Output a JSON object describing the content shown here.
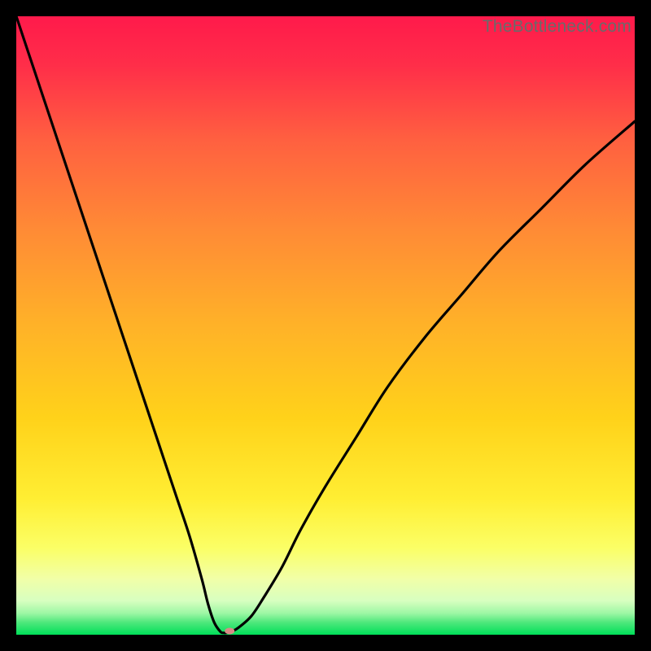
{
  "watermark": "TheBottleneck.com",
  "chart_data": {
    "type": "line",
    "title": "",
    "xlabel": "",
    "ylabel": "",
    "xlim": [
      0,
      100
    ],
    "ylim": [
      0,
      100
    ],
    "grid": false,
    "legend": false,
    "background_gradient": {
      "top_color": "#ff1a4b",
      "mid_color": "#ffd400",
      "bottom_color": "#00e05a"
    },
    "series": [
      {
        "name": "bottleneck-curve",
        "color": "#000000",
        "x": [
          0,
          2,
          4,
          6,
          8,
          10,
          12,
          14,
          16,
          18,
          20,
          22,
          24,
          26,
          28,
          30,
          31,
          32,
          33,
          33.5,
          34,
          35,
          36,
          38,
          40,
          43,
          46,
          50,
          55,
          60,
          66,
          72,
          78,
          85,
          92,
          100
        ],
        "y": [
          100,
          94,
          88,
          82,
          76,
          70,
          64,
          58,
          52,
          46,
          40,
          34,
          28,
          22,
          16,
          9,
          5,
          2,
          0.5,
          0.3,
          0.3,
          0.6,
          1.2,
          3,
          6,
          11,
          17,
          24,
          32,
          40,
          48,
          55,
          62,
          69,
          76,
          83
        ]
      }
    ],
    "marker": {
      "name": "min-point",
      "x": 34.5,
      "y": 0.6,
      "rx": 6,
      "ry": 4,
      "color": "#d88a86"
    }
  }
}
